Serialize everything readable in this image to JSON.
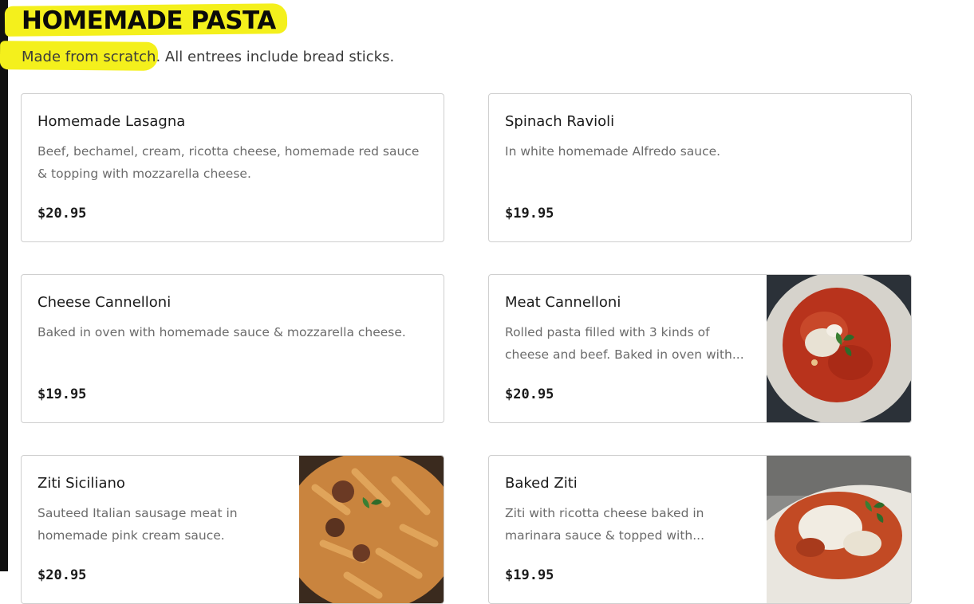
{
  "section": {
    "title": "HOMEMADE PASTA",
    "subtitle": "Made from scratch. All entrees include bread sticks."
  },
  "items": [
    {
      "name": "Homemade Lasagna",
      "description": "Beef, bechamel, cream, ricotta cheese, homemade red sauce & topping with mozzarella cheese.",
      "price": "$20.95"
    },
    {
      "name": "Spinach Ravioli",
      "description": "In white homemade Alfredo sauce.",
      "price": "$19.95"
    },
    {
      "name": "Cheese Cannelloni",
      "description": "Baked in oven with homemade sauce & mozzarella cheese.",
      "price": "$19.95"
    },
    {
      "name": "Meat Cannelloni",
      "description": "Rolled pasta filled with 3 kinds of cheese and beef. Baked in oven with...",
      "price": "$20.95"
    },
    {
      "name": "Ziti Siciliano",
      "description": "Sauteed Italian sausage meat in homemade pink cream sauce.",
      "price": "$20.95"
    },
    {
      "name": "Baked Ziti",
      "description": "Ziti with ricotta cheese baked in marinara sauce & topped with...",
      "price": "$19.95"
    }
  ]
}
